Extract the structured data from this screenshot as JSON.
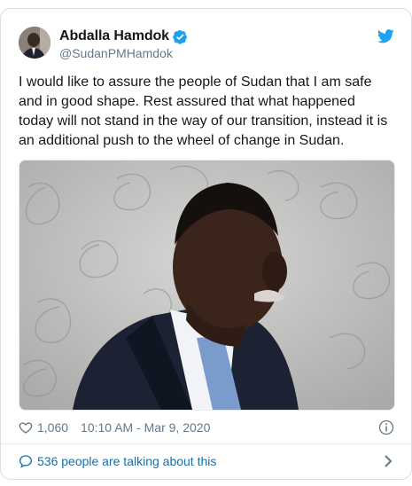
{
  "tweet": {
    "display_name": "Abdalla Hamdok",
    "handle": "@SudanPMHamdok",
    "verified": true,
    "text": "I would like to assure the people of Sudan that I am safe and in good shape. Rest assured that what happened today will not stand in the way of our transition, instead it is an additional push to the wheel of change in Sudan.",
    "likes": "1,060",
    "timestamp": "10:10 AM - Mar 9, 2020",
    "conversation_label": "536 people are talking about this"
  },
  "icons": {
    "verified": "verified-badge-icon",
    "brand": "twitter-bird-icon",
    "likes": "heart-icon",
    "info": "info-icon",
    "conversation": "speech-bubble-icon",
    "more": "chevron-right-icon"
  },
  "colors": {
    "brand_blue": "#1da1f2",
    "link_blue": "#1b6fa6",
    "text_primary": "#14171a",
    "text_secondary": "#657786",
    "border": "#d9dfe4"
  }
}
